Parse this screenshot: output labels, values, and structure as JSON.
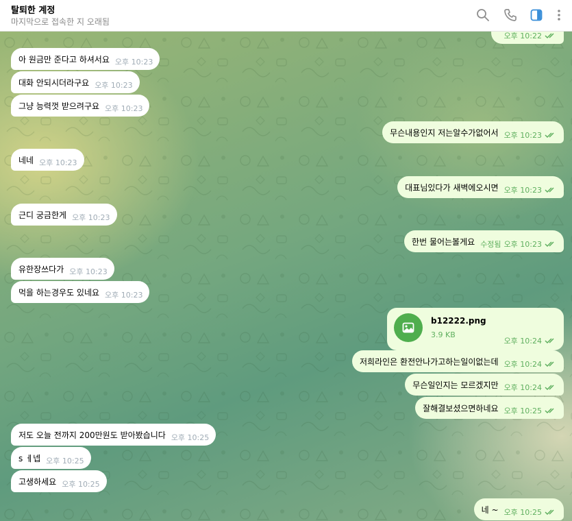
{
  "header": {
    "title": "탈퇴한 계정",
    "subtitle": "마지막으로 접속한 지 오래됨",
    "icons": [
      "search-icon",
      "phone-icon",
      "sidebar-icon",
      "more-icon"
    ]
  },
  "colors": {
    "incoming_bubble": "#ffffff",
    "outgoing_bubble": "#effdde",
    "accent": "#4fae4e",
    "active_icon": "#3a8fd9"
  },
  "messages": [
    {
      "text": "",
      "time": "오후 10:22",
      "dir": "out"
    },
    {
      "text": "아 원금만 준다고 하셔서요",
      "time": "오후 10:23",
      "dir": "in"
    },
    {
      "text": "대화 안되시더라구요",
      "time": "오후 10:23",
      "dir": "in"
    },
    {
      "text": "그냥 능력껏 받으려구요",
      "time": "오후 10:23",
      "dir": "in"
    },
    {
      "text": "무슨내용인지 저는알수가없어서",
      "time": "오후 10:23",
      "dir": "out"
    },
    {
      "text": "네네",
      "time": "오후 10:23",
      "dir": "in"
    },
    {
      "text": "대표님있다가 새벽에오시면",
      "time": "오후 10:23",
      "dir": "out"
    },
    {
      "text": "근디 궁금한게",
      "time": "오후 10:23",
      "dir": "in"
    },
    {
      "text": "한번 물어는볼게요",
      "time": "오후 10:23",
      "edited": "수정됨",
      "dir": "out"
    },
    {
      "text": "유한장쓰다가",
      "time": "오후 10:23",
      "dir": "in"
    },
    {
      "text": "먹을 하는경우도 있네요",
      "time": "오후 10:23",
      "dir": "in"
    },
    {
      "text": "저희라인은 환전안나가고하는일이없는데",
      "time": "오후 10:24",
      "dir": "out"
    },
    {
      "text": "무슨일인지는 모르겠지만",
      "time": "오후 10:24",
      "dir": "out"
    },
    {
      "text": "잘해결보셨으면하네요",
      "time": "오후 10:25",
      "dir": "out"
    },
    {
      "text": "저도 오늘 전까지 200만원도 받아봤습니다",
      "time": "오후 10:25",
      "dir": "in"
    },
    {
      "text": "s ㅔ넵",
      "time": "오후 10:25",
      "dir": "in"
    },
    {
      "text": "고생하세요",
      "time": "오후 10:25",
      "dir": "in"
    },
    {
      "text": "네 ~",
      "time": "오후 10:25",
      "dir": "out"
    }
  ],
  "file": {
    "name": "b12222.png",
    "size": "3.9 KB",
    "time": "오후 10:24",
    "icon": "image-icon"
  }
}
